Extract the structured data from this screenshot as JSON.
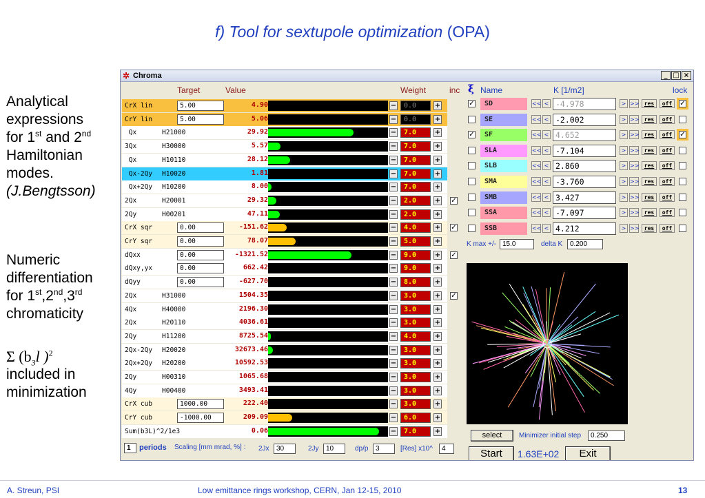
{
  "slide": {
    "title_italic": "f) Tool for sextupole optimization",
    "title_suffix": " (OPA)",
    "footer_left": "A. Streun, PSI",
    "footer_center": "Low emittance rings workshop, CERN, Jan 12-15, 2010",
    "footer_page": "13"
  },
  "side": {
    "b1_line1": "Analytical",
    "b1_line2": "expressions",
    "b1_line3_a": "for 1",
    "b1_line3_sup1": "st",
    "b1_line3_b": " and 2",
    "b1_line3_sup2": "nd",
    "b1_line4": "Hamiltonian",
    "b1_line5": "modes.",
    "b1_line6": "(J.Bengtsson)",
    "b2_line1": "Numeric",
    "b2_line2": "differentiation",
    "b2_line3_a": "for 1",
    "b2_line3_sup1": "st",
    "b2_line3_b": ",2",
    "b2_line3_sup2": "nd",
    "b2_line3_c": ",3",
    "b2_line3_sup3": "rd",
    "b2_line4": "chromaticity",
    "math_a": "Σ (b",
    "math_sub": "3",
    "math_b": "l )",
    "math_sup": "2",
    "b3_line1": "included in",
    "b3_line2": "minimization"
  },
  "window": {
    "title": "Chroma",
    "min_icon": "_",
    "max_icon": "□",
    "close_icon": "×"
  },
  "headers": {
    "target": "Target",
    "value": "Value",
    "weight": "Weight",
    "inc": "inc",
    "xi": "ξ",
    "name": "Name",
    "k": "K [1/m2]",
    "lock": "lock"
  },
  "rows": [
    {
      "label": "CrX lin",
      "target": "5.00",
      "value": "4.90",
      "weight": "0.0",
      "bar": 0,
      "color": "#00ff00",
      "bg": "orange",
      "wdark": true,
      "inc": false
    },
    {
      "label": "CrY lin",
      "target": "5.00",
      "value": "5.06",
      "weight": "0.0",
      "bar": 0,
      "color": "#00ff00",
      "bg": "orange",
      "wdark": true,
      "inc": false
    },
    {
      "label": " Qx",
      "mode": "H21000",
      "value": "29.92",
      "weight": "7.0",
      "bar": 0.74,
      "color": "#00ff00",
      "bg": "white",
      "inc": false
    },
    {
      "label": "3Qx",
      "mode": "H30000",
      "value": "5.57",
      "weight": "7.0",
      "bar": 0.11,
      "color": "#00ff00",
      "bg": "white",
      "inc": false
    },
    {
      "label": " Qx",
      "mode": "H10110",
      "value": "28.12",
      "weight": "7.0",
      "bar": 0.19,
      "color": "#00ff00",
      "bg": "white",
      "inc": false
    },
    {
      "label": " Qx-2Qy",
      "mode": "H10020",
      "value": "1.81",
      "weight": "7.0",
      "bar": 0.0,
      "color": "#00ff00",
      "bg": "cyan",
      "inc": false
    },
    {
      "label": " Qx+2Qy",
      "mode": "H10200",
      "value": "8.00",
      "weight": "7.0",
      "bar": 0.03,
      "color": "#00ff00",
      "bg": "white",
      "inc": false
    },
    {
      "label": "2Qx",
      "mode": "H20001",
      "value": "29.32",
      "weight": "2.0",
      "bar": 0.07,
      "color": "#00ff00",
      "bg": "white",
      "inc": true
    },
    {
      "label": "2Qy",
      "mode": "H00201",
      "value": "47.11",
      "weight": "2.0",
      "bar": 0.1,
      "color": "#00ff00",
      "bg": "white",
      "inc": false
    },
    {
      "label": "CrX sqr",
      "target": "0.00",
      "value": "-151.62",
      "weight": "4.0",
      "bar": 0.16,
      "color": "#ffc000",
      "bg": "cream",
      "inc": true
    },
    {
      "label": "CrY sqr",
      "target": "0.00",
      "value": "78.07",
      "weight": "5.0",
      "bar": 0.24,
      "color": "#ffc000",
      "bg": "cream",
      "inc": false
    },
    {
      "label": "dQxx",
      "target": "0.00",
      "value": "-1321.52",
      "weight": "9.0",
      "bar": 0.72,
      "color": "#00ff00",
      "bg": "white",
      "inc": true
    },
    {
      "label": "dQxy,yx",
      "target": "0.00",
      "value": "662.42",
      "weight": "9.0",
      "bar": 0,
      "color": "#00ff00",
      "bg": "white",
      "inc": false
    },
    {
      "label": "dQyy",
      "target": "0.00",
      "value": "-627.70",
      "weight": "8.0",
      "bar": 0,
      "color": "#00ff00",
      "bg": "white",
      "inc": false
    },
    {
      "label": "2Qx",
      "mode": "H31000",
      "value": "1504.35",
      "weight": "3.0",
      "bar": 0,
      "color": "#00ff00",
      "bg": "white",
      "inc": true
    },
    {
      "label": "4Qx",
      "mode": "H40000",
      "value": "2196.30",
      "weight": "3.0",
      "bar": 0,
      "color": "#00ff00",
      "bg": "white",
      "inc": false
    },
    {
      "label": "2Qx",
      "mode": "H20110",
      "value": "4036.61",
      "weight": "3.0",
      "bar": 0,
      "color": "#00ff00",
      "bg": "white",
      "inc": false
    },
    {
      "label": "2Qy",
      "mode": "H11200",
      "value": "8725.54",
      "weight": "4.0",
      "bar": 0.01,
      "color": "#00ff00",
      "bg": "white",
      "inc": false
    },
    {
      "label": "2Qx-2Qy",
      "mode": "H20020",
      "value": "32673.46",
      "weight": "3.0",
      "bar": 0.04,
      "color": "#00ff00",
      "bg": "white",
      "inc": false
    },
    {
      "label": "2Qx+2Qy",
      "mode": "H20200",
      "value": "10592.53",
      "weight": "3.0",
      "bar": 0,
      "color": "#00ff00",
      "bg": "white",
      "inc": false
    },
    {
      "label": "2Qy",
      "mode": "H00310",
      "value": "1065.68",
      "weight": "3.0",
      "bar": 0,
      "color": "#00ff00",
      "bg": "white",
      "inc": false
    },
    {
      "label": "4Qy",
      "mode": "H00400",
      "value": "3493.41",
      "weight": "3.0",
      "bar": 0,
      "color": "#00ff00",
      "bg": "white",
      "inc": false
    },
    {
      "label": "CrX cub",
      "target": "1000.00",
      "value": "222.40",
      "weight": "3.0",
      "bar": 0,
      "color": "#ffc000",
      "bg": "cream",
      "inc": false
    },
    {
      "label": "CrY cub",
      "target": "-1000.00",
      "value": "209.09",
      "weight": "6.0",
      "bar": 0.21,
      "color": "#ffc000",
      "bg": "cream",
      "inc": false
    },
    {
      "label": "Sum(b3L)^2/1e3",
      "value": "0.06",
      "weight": "7.0",
      "bar": 0.96,
      "color": "#00ff00",
      "bg": "white",
      "inc": false
    }
  ],
  "sextupoles": [
    {
      "name": "SD",
      "k": "-4.978",
      "color": "#ff9ab0",
      "checked": true,
      "locked": true,
      "disabled": true,
      "bg": "#f9c040"
    },
    {
      "name": "SE",
      "k": "-2.002",
      "color": "#a6a6ff",
      "checked": false,
      "locked": false,
      "disabled": false,
      "bg": ""
    },
    {
      "name": "SF",
      "k": "4.652",
      "color": "#99ff66",
      "checked": true,
      "locked": true,
      "disabled": true,
      "bg": "#f9c040"
    },
    {
      "name": "SLA",
      "k": "-7.104",
      "color": "#ff99ff",
      "checked": false,
      "locked": false,
      "disabled": false,
      "bg": ""
    },
    {
      "name": "SLB",
      "k": "2.860",
      "color": "#99ffff",
      "checked": false,
      "locked": false,
      "disabled": false,
      "bg": ""
    },
    {
      "name": "SMA",
      "k": "-3.760",
      "color": "#ffff99",
      "checked": false,
      "locked": false,
      "disabled": false,
      "bg": ""
    },
    {
      "name": "SMB",
      "k": "3.427",
      "color": "#a6a6ff",
      "checked": false,
      "locked": false,
      "disabled": false,
      "bg": ""
    },
    {
      "name": "SSA",
      "k": "-7.097",
      "color": "#ff99aa",
      "checked": false,
      "locked": false,
      "disabled": false,
      "bg": ""
    },
    {
      "name": "SSB",
      "k": "4.212",
      "color": "#ff99aa",
      "checked": false,
      "locked": false,
      "disabled": false,
      "bg": ""
    }
  ],
  "sext_buttons": {
    "ll": "<<",
    "l": "<",
    "r": ">",
    "rr": ">>",
    "res": "res",
    "off": "off"
  },
  "kmax": {
    "label": "K max +/-",
    "value": "15.0",
    "dk_label": "delta K",
    "dk_value": "0.200"
  },
  "bottom": {
    "periods_value": "1",
    "periods_label": "periods",
    "scaling_label": "Scaling [mm mrad, %] :",
    "jx_label": "2Jx",
    "jx_value": "30",
    "jy_label": "2Jy",
    "jy_value": "10",
    "dpp_label": "dp/p",
    "dpp_value": "3",
    "res_label": "[Res] x10^",
    "res_value": "4"
  },
  "controls": {
    "select": "select",
    "step_label": "Minimizer initial step",
    "step_value": "0.250",
    "start": "Start",
    "result": "1.63E+02",
    "exit": "Exit"
  },
  "plot_colors": [
    "#ff66aa",
    "#99ff66",
    "#ffff66",
    "#66ffff",
    "#ff99ff",
    "#aaaaff",
    "#ffffff",
    "#ff9966"
  ]
}
